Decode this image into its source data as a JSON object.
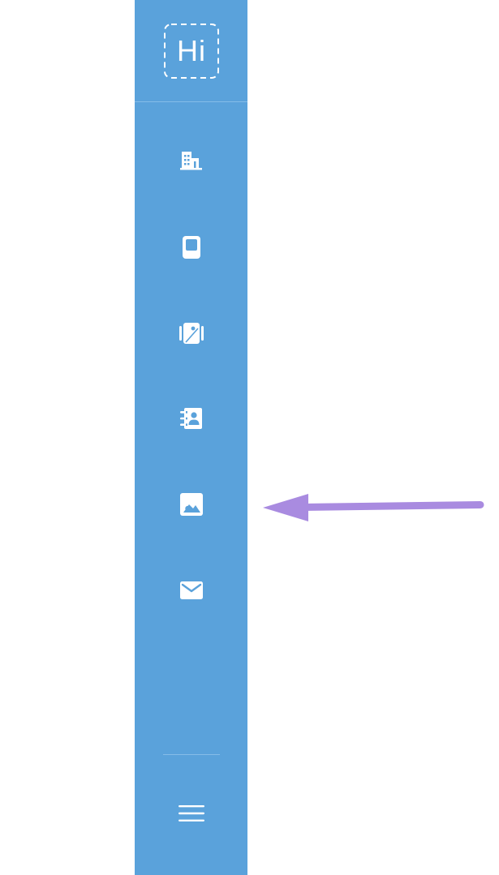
{
  "logo": {
    "text": "Hi"
  },
  "nav_icons": [
    "building-icon",
    "tablet-icon",
    "gallery-icon",
    "contacts-icon",
    "image-icon",
    "mail-icon"
  ],
  "menu": {
    "icon": "hamburger-menu-icon"
  },
  "colors": {
    "sidebar": "#5aa2db",
    "icon": "#ffffff",
    "annotation_arrow": "#a98be0"
  }
}
